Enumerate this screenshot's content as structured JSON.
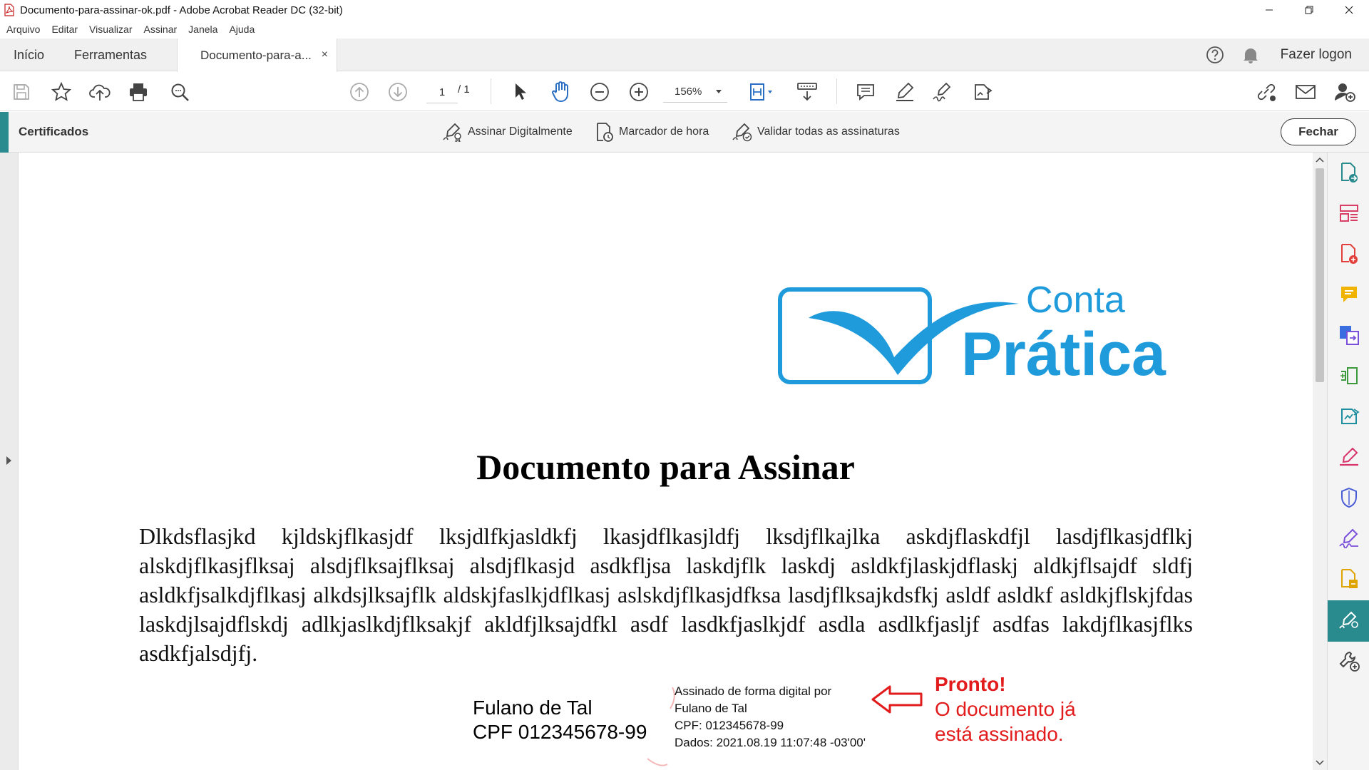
{
  "window": {
    "title": "Documento-para-assinar-ok.pdf - Adobe Acrobat Reader DC (32-bit)"
  },
  "menu": [
    "Arquivo",
    "Editar",
    "Visualizar",
    "Assinar",
    "Janela",
    "Ajuda"
  ],
  "tabs": {
    "home": "Início",
    "tools": "Ferramentas",
    "document": "Documento-para-a...",
    "close_symbol": "×"
  },
  "header": {
    "login": "Fazer logon"
  },
  "toolbar": {
    "page_current": "1",
    "page_total": "/ 1",
    "zoom": "156%"
  },
  "certbar": {
    "title": "Certificados",
    "actions": [
      "Assinar Digitalmente",
      "Marcador de hora",
      "Validar todas as assinaturas"
    ],
    "close": "Fechar"
  },
  "document": {
    "logo_line1": "Conta",
    "logo_line2": "Prática",
    "title": "Documento para Assinar",
    "body": "Dlkdsflasjkd kjldskjflkasjdf lksjdlfkjasldkfj lkasjdflkasjldfj lksdjflkajlka askdjflaskdfjl lasdjflkasjdflkj alskdjflkasjflksaj alsdjflksajflksaj alsdjflkasjd asdkfljsa laskdjflk laskdj asldkfjlaskjdflaskj aldkjflsajdf sldfj asldkfjsalkdjflkasj alkdsjlksajflk aldskjfaslkjdflkasj aslskdjflkasjdfksa lasdjflksajkdsfkj asldf asldkf asldkjflskjfdas laskdjlsajdflskdj adlkjaslkdjflksakjf akldfjlksajdfkl asdf lasdkfjaslkjdf asdla asdlkfjasljf asdfas lakdjflkasjflks asdkfjalsdjfj.",
    "signer_name": "Fulano de Tal",
    "signer_cpf": "CPF 012345678-99",
    "stamp": {
      "line1": "Assinado de forma digital por",
      "line2": "Fulano de Tal",
      "line3": "CPF: 012345678-99",
      "line4": "Dados: 2021.08.19 11:07:48 -03'00'"
    },
    "annotation": {
      "title": "Pronto!",
      "line1": "O documento já",
      "line2": "está assinado."
    }
  },
  "colors": {
    "accent": "#2a8b8e",
    "logo_blue": "#1f9bdc",
    "annotation_red": "#e21c1c"
  }
}
